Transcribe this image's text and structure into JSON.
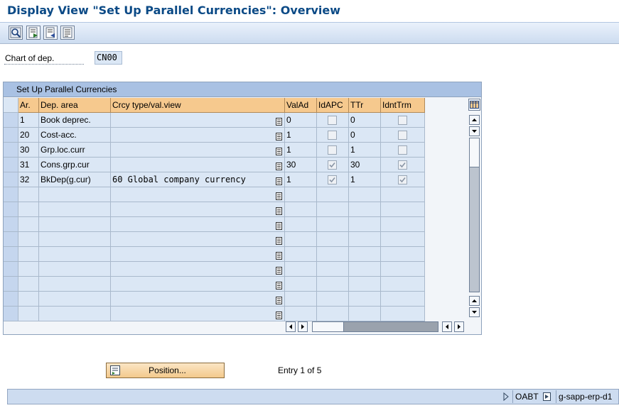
{
  "window": {
    "title": "Display View \"Set Up Parallel Currencies\": Overview"
  },
  "toolbar": {
    "buttons": [
      {
        "icon": "search-icon"
      },
      {
        "icon": "export-icon"
      },
      {
        "icon": "import-icon"
      },
      {
        "icon": "document-icon"
      }
    ]
  },
  "selection": {
    "label": "Chart of dep.",
    "value": "CN00"
  },
  "table": {
    "title": "Set Up Parallel Currencies",
    "columns": [
      "Ar.",
      "Dep. area",
      "Crcy type/val.view",
      "ValAd",
      "IdAPC",
      "TTr",
      "IdntTrm"
    ],
    "rows": [
      {
        "area": "1",
        "dep_area": "Book deprec.",
        "crcy": "",
        "valad": "0",
        "idapc": false,
        "ttr": "0",
        "idnttrm": false
      },
      {
        "area": "20",
        "dep_area": "Cost-acc.",
        "crcy": "",
        "valad": "1",
        "idapc": false,
        "ttr": "0",
        "idnttrm": false
      },
      {
        "area": "30",
        "dep_area": "Grp.loc.curr",
        "crcy": "",
        "valad": "1",
        "idapc": false,
        "ttr": "1",
        "idnttrm": false
      },
      {
        "area": "31",
        "dep_area": "Cons.grp.cur",
        "crcy": "",
        "valad": "30",
        "idapc": true,
        "ttr": "30",
        "idnttrm": true
      },
      {
        "area": "32",
        "dep_area": "BkDep(g.cur)",
        "crcy": "60 Global company currency",
        "valad": "1",
        "idapc": true,
        "ttr": "1",
        "idnttrm": true
      }
    ],
    "empty_rows": 9
  },
  "footer": {
    "position_button": "Position...",
    "entry_text": "Entry 1 of 5"
  },
  "status_bar": {
    "transaction": "OABT",
    "server": "g-sapp-erp-d1"
  },
  "colors": {
    "title": "#0b4a86",
    "header_cell": "#f6c98e",
    "body_cell": "#dbe7f5",
    "panel_title": "#a9c1e3"
  }
}
